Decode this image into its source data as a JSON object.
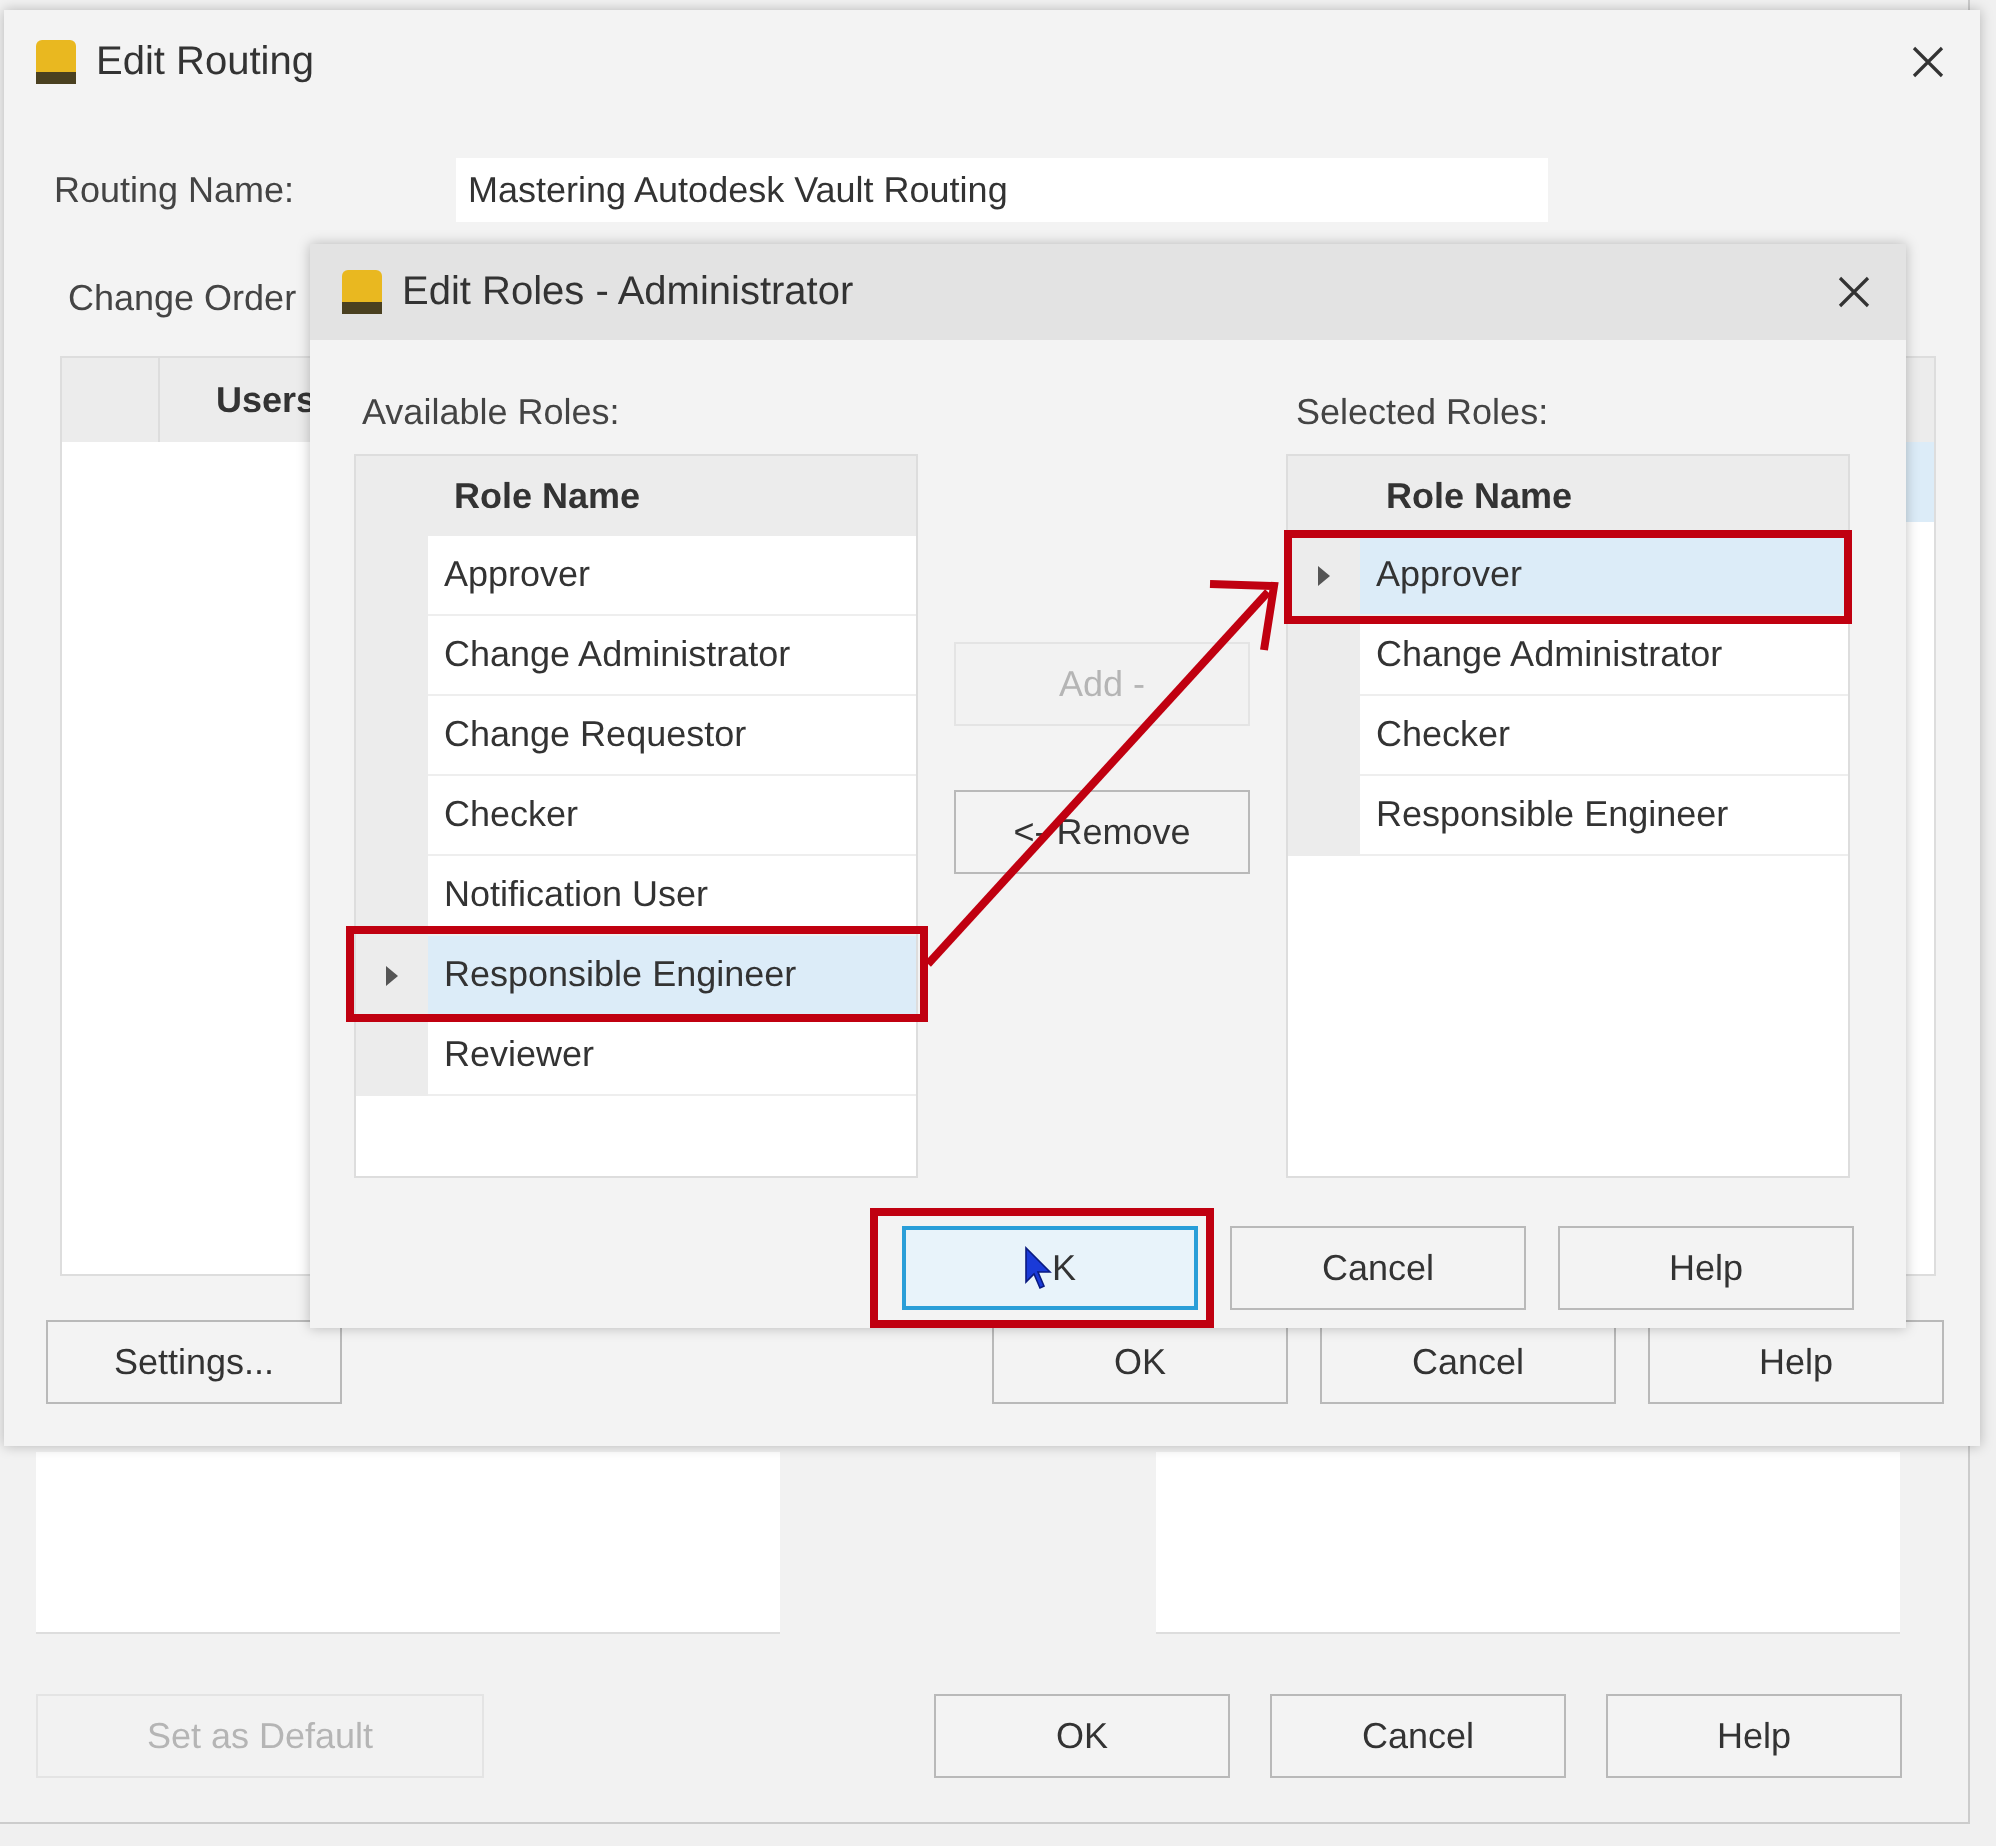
{
  "back_window": {
    "buttons": [
      {
        "label": "Set as Default",
        "disabled": true
      },
      {
        "label": "OK",
        "disabled": false
      },
      {
        "label": "Cancel",
        "disabled": false
      },
      {
        "label": "Help",
        "disabled": false
      }
    ]
  },
  "edit_routing": {
    "title": "Edit Routing",
    "routing_name_label": "Routing Name:",
    "routing_name_value": "Mastering Autodesk Vault Routing",
    "change_order_label": "Change Order",
    "users_column": "Users",
    "buttons": [
      {
        "label": "Settings...",
        "default": false
      },
      {
        "label": "OK",
        "default": false
      },
      {
        "label": "Cancel",
        "default": false
      },
      {
        "label": "Help",
        "default": false
      }
    ]
  },
  "edit_roles": {
    "title": "Edit Roles - Administrator",
    "available_label": "Available Roles:",
    "available_roles": {
      "column": "Role Name",
      "rows": [
        {
          "name": "Approver",
          "selected": false
        },
        {
          "name": "Change Administrator",
          "selected": false
        },
        {
          "name": "Change Requestor",
          "selected": false
        },
        {
          "name": "Checker",
          "selected": false
        },
        {
          "name": "Notification User",
          "selected": false
        },
        {
          "name": "Responsible Engineer",
          "selected": true
        },
        {
          "name": "Reviewer",
          "selected": false
        }
      ]
    },
    "add_button": {
      "label": "Add -",
      "disabled": true
    },
    "remove_button": {
      "label": "<- Remove",
      "disabled": false
    },
    "selected_label": "Selected Roles:",
    "selected_roles": {
      "column": "Role Name",
      "rows": [
        {
          "name": "Approver",
          "selected": true
        },
        {
          "name": "Change Administrator",
          "selected": false
        },
        {
          "name": "Checker",
          "selected": false
        },
        {
          "name": "Responsible Engineer",
          "selected": false
        }
      ]
    },
    "buttons": [
      {
        "label": "K",
        "default": true
      },
      {
        "label": "Cancel",
        "default": false
      },
      {
        "label": "Help",
        "default": false
      }
    ]
  }
}
